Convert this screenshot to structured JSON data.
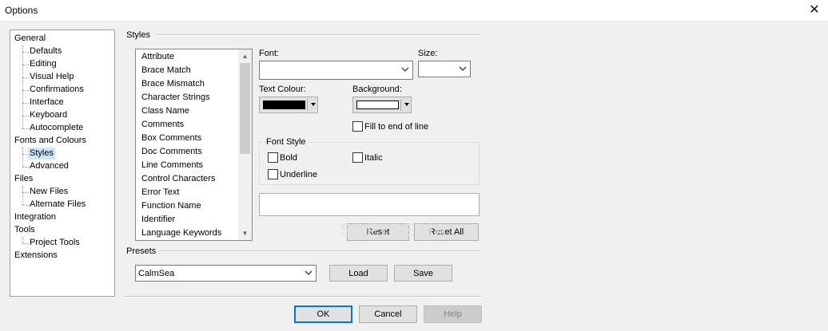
{
  "window": {
    "title": "Options",
    "close_glyph": "✕"
  },
  "tree": {
    "items": [
      {
        "label": "General",
        "level": 0
      },
      {
        "label": "Defaults",
        "level": 1
      },
      {
        "label": "Editing",
        "level": 1
      },
      {
        "label": "Visual Help",
        "level": 1
      },
      {
        "label": "Confirmations",
        "level": 1
      },
      {
        "label": "Interface",
        "level": 1
      },
      {
        "label": "Keyboard",
        "level": 1
      },
      {
        "label": "Autocomplete",
        "level": 1
      },
      {
        "label": "Fonts and Colours",
        "level": 0
      },
      {
        "label": "Styles",
        "level": 1,
        "selected": true
      },
      {
        "label": "Advanced",
        "level": 1
      },
      {
        "label": "Files",
        "level": 0
      },
      {
        "label": "New Files",
        "level": 1
      },
      {
        "label": "Alternate Files",
        "level": 1
      },
      {
        "label": "Integration",
        "level": 0
      },
      {
        "label": "Tools",
        "level": 0
      },
      {
        "label": "Project Tools",
        "level": 1
      },
      {
        "label": "Extensions",
        "level": 0
      }
    ]
  },
  "styles": {
    "group_label": "Styles",
    "list_items": [
      "Attribute",
      "Brace Match",
      "Brace Mismatch",
      "Character Strings",
      "Class Name",
      "Comments",
      "Box Comments",
      "Doc Comments",
      "Line Comments",
      "Control Characters",
      "Error Text",
      "Function Name",
      "Identifier",
      "Language Keywords"
    ],
    "font_label": "Font:",
    "font_value": "",
    "size_label": "Size:",
    "size_value": "",
    "text_colour_label": "Text Colour:",
    "text_colour_value": "#000000",
    "background_label": "Background:",
    "background_value": "#ffffff",
    "fill_label": "Fill to end of line",
    "font_style_label": "Font Style",
    "bold_label": "Bold",
    "italic_label": "Italic",
    "underline_label": "Underline",
    "reset_label": "Reset",
    "reset_all_label": "Reset All"
  },
  "presets": {
    "group_label": "Presets",
    "selected": "CalmSea",
    "load_label": "Load",
    "save_label": "Save"
  },
  "footer": {
    "ok_label": "OK",
    "cancel_label": "Cancel",
    "help_label": "Help"
  },
  "watermark": "SOFTPEDIA",
  "colors": {
    "accent": "#0078d7",
    "selection": "#cce8ff"
  }
}
